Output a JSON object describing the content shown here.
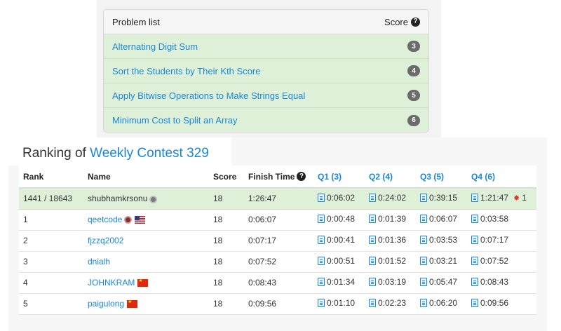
{
  "problems": {
    "header_label": "Problem list",
    "score_label": "Score",
    "items": [
      {
        "title": "Alternating Digit Sum",
        "score": "3"
      },
      {
        "title": "Sort the Students by Their Kth Score",
        "score": "4"
      },
      {
        "title": "Apply Bitwise Operations to Make Strings Equal",
        "score": "5"
      },
      {
        "title": "Minimum Cost to Split an Array",
        "score": "6"
      }
    ]
  },
  "ranking": {
    "title_prefix": "Ranking of ",
    "contest_name": "Weekly Contest 329",
    "columns": {
      "rank": "Rank",
      "name": "Name",
      "score": "Score",
      "finish": "Finish Time",
      "q1": "Q1 (3)",
      "q2": "Q2 (4)",
      "q3": "Q3 (5)",
      "q4": "Q4 (6)"
    },
    "rows": [
      {
        "rank": "1441 / 18643",
        "name": "shubhamkrsonu",
        "score": "18",
        "finish": "1:26:47",
        "q1": "0:06:02",
        "q2": "0:24:02",
        "q3": "0:39:15",
        "q4": "1:21:47",
        "q4_bugs": "1"
      },
      {
        "rank": "1",
        "name": "qeetcode",
        "score": "18",
        "finish": "0:06:07",
        "q1": "0:00:48",
        "q2": "0:01:39",
        "q3": "0:06:07",
        "q4": "0:03:58"
      },
      {
        "rank": "2",
        "name": "fjzzq2002",
        "score": "18",
        "finish": "0:07:17",
        "q1": "0:00:41",
        "q2": "0:01:36",
        "q3": "0:03:53",
        "q4": "0:07:17"
      },
      {
        "rank": "3",
        "name": "dnialh",
        "score": "18",
        "finish": "0:07:52",
        "q1": "0:00:51",
        "q2": "0:01:52",
        "q3": "0:03:21",
        "q4": "0:07:52"
      },
      {
        "rank": "4",
        "name": "JOHNKRAM",
        "score": "18",
        "finish": "0:08:43",
        "q1": "0:01:34",
        "q2": "0:03:19",
        "q3": "0:05:47",
        "q4": "0:08:43"
      },
      {
        "rank": "5",
        "name": "paigulong",
        "score": "18",
        "finish": "0:09:56",
        "q1": "0:01:10",
        "q2": "0:02:23",
        "q3": "0:06:20",
        "q4": "0:09:56"
      }
    ]
  }
}
